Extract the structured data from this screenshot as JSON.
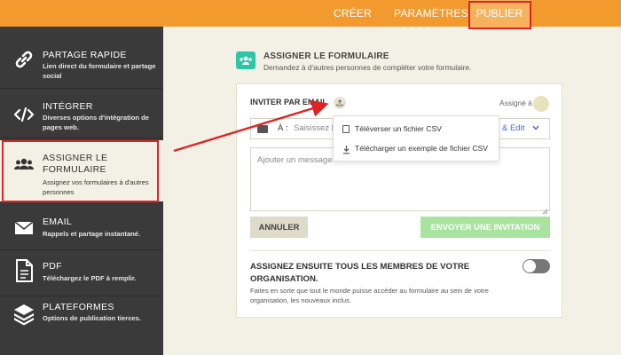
{
  "topnav": {
    "creer": "CRÉER",
    "parametres": "PARAMÈTRES",
    "publier": "PUBLIER"
  },
  "sidebar": {
    "items": [
      {
        "title": "PARTAGE RAPIDE",
        "desc": "Lien direct du formulaire et partage social",
        "icon": "link-icon"
      },
      {
        "title": "INTÉGRER",
        "desc": "Diverses options d'intégration de pages web.",
        "icon": "code-icon"
      },
      {
        "title": "ASSIGNER LE FORMULAIRE",
        "desc": "Assignez vos formulaires à d'autres personnes",
        "icon": "users-icon"
      },
      {
        "title": "EMAIL",
        "desc": "Rappels et partage instantané.",
        "icon": "mail-icon"
      },
      {
        "title": "PDF",
        "desc": "Téléchargez le PDF à remplir.",
        "icon": "pdf-icon"
      },
      {
        "title": "PLATEFORMES",
        "desc": "Options de publication tierces.",
        "icon": "layers-icon"
      }
    ]
  },
  "section": {
    "title": "ASSIGNER LE FORMULAIRE",
    "subtitle": "Demandez à d'autres personnes de compléter votre formulaire."
  },
  "invite": {
    "label": "INVITER PAR EMAIL",
    "assigned_label": "Assigné à",
    "to_label": "À :",
    "to_placeholder": "Saisissez l",
    "assign_edit": "& Edit",
    "message_placeholder": "Ajouter un message",
    "cancel": "ANNULER",
    "send": "ENVOYER UNE INVITATION"
  },
  "dropdown": {
    "items": [
      {
        "label": "Téléverser un fichier CSV",
        "icon": "upload-file-icon"
      },
      {
        "label": "Télécharger un exemple de fichier CSV",
        "icon": "download-icon"
      }
    ]
  },
  "assign_all": {
    "title": "ASSIGNEZ ENSUITE TOUS LES MEMBRES DE VOTRE ORGANISATION.",
    "desc": "Faites en sorte que tout le monde puisse accéder au formulaire au sein de votre organisation, les nouveaux inclus.",
    "toggle_on": false
  },
  "colors": {
    "topbar": "#f29a2e",
    "sidebar": "#3a3a3a",
    "accent_teal": "#2dc6a8",
    "send_button": "#a9e3a0",
    "highlight": "#e02424",
    "link_blue": "#4a6ad6"
  }
}
